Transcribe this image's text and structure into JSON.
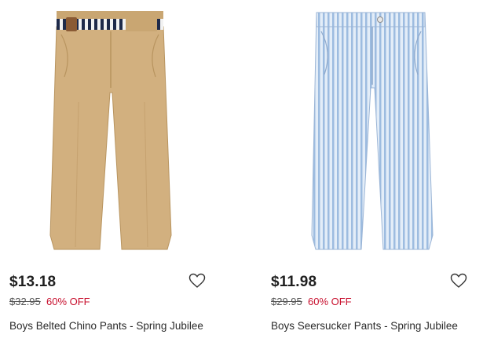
{
  "products": [
    {
      "price": "$13.18",
      "original_price": "$32.95",
      "discount": "60% OFF",
      "name": "Boys Belted Chino Pants - Spring Jubilee",
      "image_icon": "khaki-chino-pants-image",
      "colors": {
        "fabric": "#d2b07f",
        "belt_stripe_dark": "#1e2a4a",
        "belt_stripe_light": "#f2f2f2"
      }
    },
    {
      "price": "$11.98",
      "original_price": "$29.95",
      "discount": "60% OFF",
      "name": "Boys Seersucker Pants - Spring Jubilee",
      "image_icon": "seersucker-pants-image",
      "colors": {
        "fabric": "#cfe0f2",
        "stripe": "#9dbce0"
      }
    }
  ],
  "ui_colors": {
    "discount": "#c8102e",
    "text": "#1f1f1f",
    "muted": "#555555"
  },
  "wishlist_icon": "heart-outline-icon"
}
